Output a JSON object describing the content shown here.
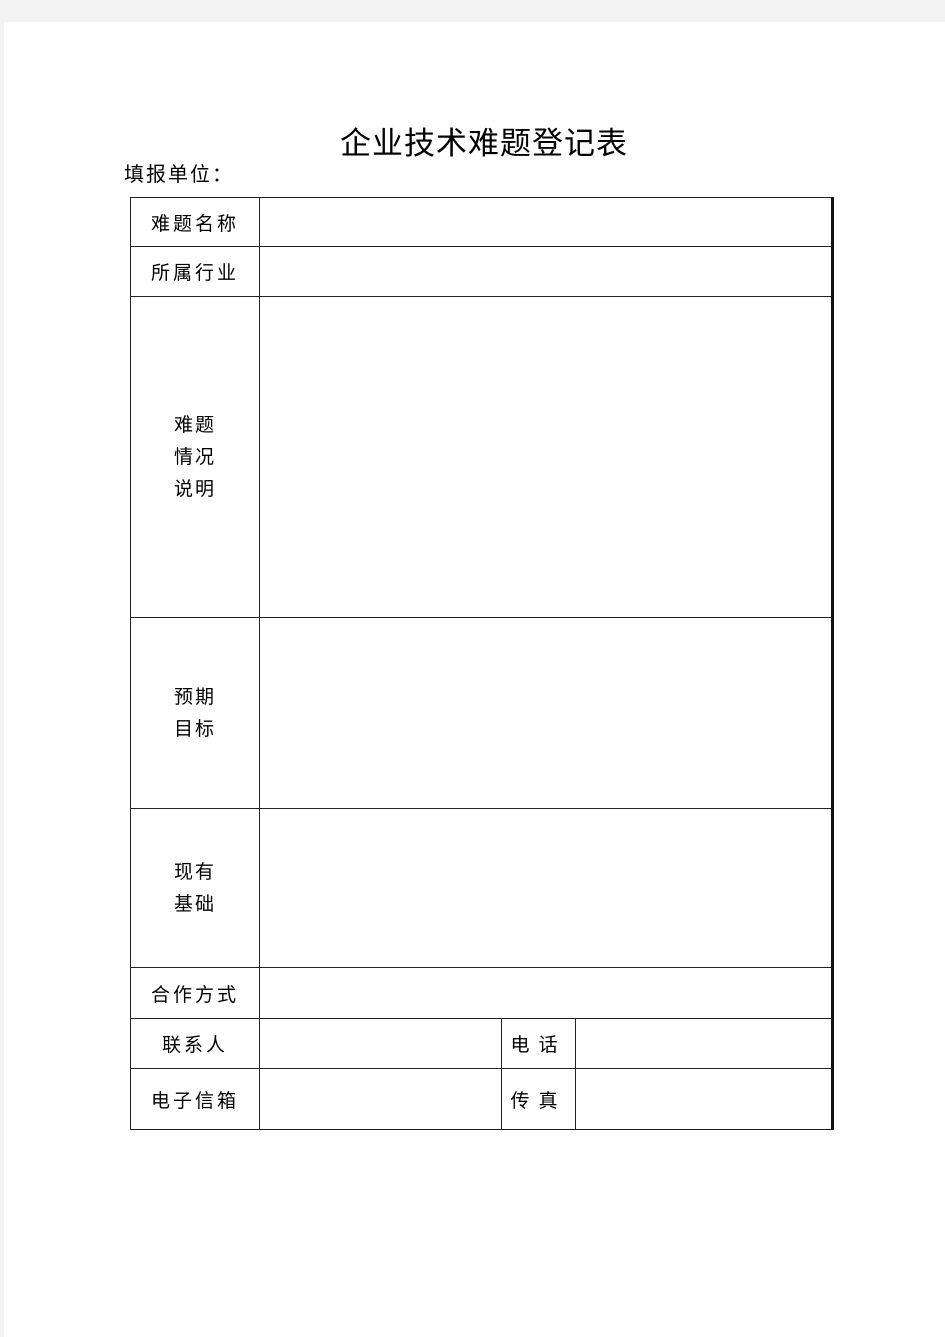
{
  "document": {
    "title": "企业技术难题登记表",
    "unit_label": "填报单位："
  },
  "form": {
    "problem_name": {
      "label": "难题名称",
      "value": ""
    },
    "industry": {
      "label": "所属行业",
      "value": ""
    },
    "problem_description": {
      "label_lines": [
        "难题",
        "情况",
        "说明"
      ],
      "value": ""
    },
    "expected_goal": {
      "label_lines": [
        "预期",
        "目标"
      ],
      "value": ""
    },
    "existing_basis": {
      "label_lines": [
        "现有",
        "基础"
      ],
      "value": ""
    },
    "cooperation_mode": {
      "label": "合作方式",
      "value": ""
    },
    "contact_person": {
      "label": "联系人",
      "value": ""
    },
    "phone": {
      "label": "电话",
      "value": ""
    },
    "email": {
      "label": "电子信箱",
      "value": ""
    },
    "fax": {
      "label": "传真",
      "value": ""
    }
  }
}
